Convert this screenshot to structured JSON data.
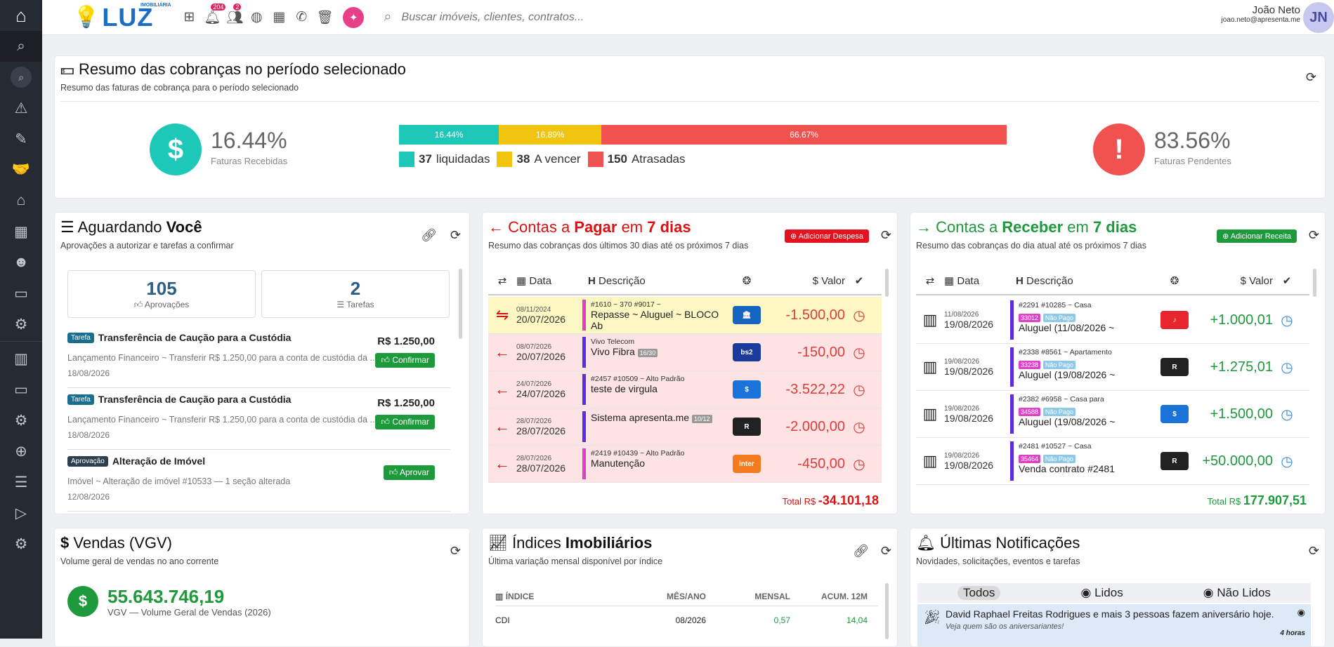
{
  "topbar": {
    "brand_small": "IMOBILIÁRIA",
    "brand": "LUZ",
    "notif_badge": "204",
    "users_badge": "2",
    "search_placeholder": "Buscar imóveis, clientes, contratos...",
    "user_name": "João Neto",
    "user_email": "joao.neto@apresenta.me",
    "avatar": "JN"
  },
  "resumo": {
    "title": "Resumo das cobranças no período selecionado",
    "subtitle": "Resumo das faturas de cobrança para o período selecionado",
    "recebidas_pct": "16.44%",
    "recebidas_label": "Faturas Recebidas",
    "pendentes_pct": "83.56%",
    "pendentes_label": "Faturas Pendentes",
    "bar": [
      {
        "label": "16.44%",
        "value": 16.44,
        "color": "#1ec8b8"
      },
      {
        "label": "16.89%",
        "value": 16.89,
        "color": "#f1c40f"
      },
      {
        "label": "66.67%",
        "value": 66.67,
        "color": "#f0524f"
      }
    ],
    "legend": [
      {
        "count": "37",
        "label": "liquidadas",
        "color": "#1ec8b8"
      },
      {
        "count": "38",
        "label": "A vencer",
        "color": "#f1c40f"
      },
      {
        "count": "150",
        "label": "Atrasadas",
        "color": "#f0524f"
      }
    ]
  },
  "aguardando": {
    "title_a": "Aguardando ",
    "title_b": "Você",
    "subtitle": "Aprovações a autorizar e tarefas a confirmar",
    "aprovacoes_count": "105",
    "aprovacoes_label": "Aprovações",
    "tarefas_count": "2",
    "tarefas_label": "Tarefas",
    "items": [
      {
        "badge": "Tarefa",
        "title": "Transferência de Caução para a Custódia",
        "sub": "Lançamento Financeiro ~ Transferir R$ 1.250,00 para a conta de custódia da ...",
        "date": "18/08/2026",
        "value": "R$ 1.250,00",
        "button": "Confirmar"
      },
      {
        "badge": "Tarefa",
        "title": "Transferência de Caução para a Custódia",
        "sub": "Lançamento Financeiro ~ Transferir R$ 1.250,00 para a conta de custódia da ...",
        "date": "18/08/2026",
        "value": "R$ 1.250,00",
        "button": "Confirmar"
      },
      {
        "badge": "Aprovação",
        "title": "Alteração de Imóvel",
        "sub": "Imóvel ~ Alteração de imóvel #10533 — 1 seção alterada",
        "date": "12/08/2026",
        "value": "",
        "button": "Aprovar"
      }
    ]
  },
  "pagar": {
    "title_a": "Contas a ",
    "title_b": "Pagar",
    "title_c": " em ",
    "title_d": "7 dias",
    "subtitle": "Resumo das cobranças dos últimos 30 dias até os próximos 7 dias",
    "add_button": "Adicionar Despesa",
    "col_data": "Data",
    "col_desc": "Descrição",
    "col_valor": "Valor",
    "rows": [
      {
        "d1": "08/11/2024",
        "d2": "20/07/2026",
        "meta": "#1610 ~ 370  #9017 ~",
        "desc": "Repasse ~ Aluguel ~ BLOCO",
        "desc2": "Ab",
        "logo": "🏛",
        "logo_color": "#1565c0",
        "value": "-1.500,00",
        "bg": "#fdf7c3",
        "mark": "#e040c8"
      },
      {
        "d1": "08/07/2026",
        "d2": "20/07/2026",
        "meta": "Vivo Telecom",
        "desc": "Vivo Fibra",
        "tag": "16/30",
        "logo": "bs2",
        "logo_color": "#1b3a9e",
        "value": "-150,00",
        "bg": "#fde3e3",
        "mark": "#5a2ee0"
      },
      {
        "d1": "24/07/2026",
        "d2": "24/07/2026",
        "meta": "#2457  #10509 ~ Alto Padrão",
        "desc": "teste de virgula",
        "logo": "$",
        "logo_color": "#1a73d9",
        "value": "-3.522,22",
        "bg": "#fde3e3",
        "mark": "#5a2ee0"
      },
      {
        "d1": "28/07/2026",
        "d2": "28/07/2026",
        "meta": "",
        "desc": "Sistema apresenta.me",
        "tag": "10/12",
        "logo": "R",
        "logo_color": "#222",
        "value": "-2.000,00",
        "bg": "#fde3e3",
        "mark": "#5a2ee0"
      },
      {
        "d1": "28/07/2026",
        "d2": "28/07/2026",
        "meta": "#2419  #10439 ~ Alto Padrão",
        "desc": "Manutenção",
        "logo": "inter",
        "logo_color": "#f47a20",
        "value": "-450,00",
        "bg": "#fde3e3",
        "mark": "#e040c8"
      }
    ],
    "total_label": "Total R$",
    "total": "-34.101,18"
  },
  "receber": {
    "title_a": "Contas a ",
    "title_b": "Receber",
    "title_c": " em ",
    "title_d": "7 dias",
    "subtitle": "Resumo das cobranças do dia atual até os próximos 7 dias",
    "add_button": "Adicionar Receita",
    "col_data": "Data",
    "col_desc": "Descrição",
    "col_valor": "Valor",
    "rows": [
      {
        "d1": "11/08/2026",
        "d2": "19/08/2026",
        "meta": "#2291  #10285 ~ Casa",
        "num": "33012",
        "status": "Não Pago",
        "desc": "Aluguel (11/08/2026 ~",
        "logo": "♪",
        "logo_color": "#e8242f",
        "value": "+1.000,01"
      },
      {
        "d1": "19/08/2026",
        "d2": "19/08/2026",
        "meta": "#2338  #8561 ~ Apartamento",
        "num": "33238",
        "status": "Não Pago",
        "desc": "Aluguel (19/08/2026 ~",
        "logo": "R",
        "logo_color": "#222",
        "value": "+1.275,01"
      },
      {
        "d1": "19/08/2026",
        "d2": "19/08/2026",
        "meta": "#2382  #6958 ~ Casa para",
        "num": "34588",
        "status": "Não Pago",
        "desc": "Aluguel (19/08/2026 ~",
        "logo": "$",
        "logo_color": "#1a73d9",
        "value": "+1.500,00"
      },
      {
        "d1": "19/08/2026",
        "d2": "19/08/2026",
        "meta": "#2481  #10527 ~ Casa",
        "num": "35464",
        "status": "Não Pago",
        "desc": "Venda contrato #2481",
        "logo": "R",
        "logo_color": "#222",
        "value": "+50.000,00"
      }
    ],
    "total_label": "Total R$",
    "total": "177.907,51"
  },
  "vendas": {
    "title": "Vendas (VGV)",
    "subtitle": "Volume geral de vendas no ano corrente",
    "value": "55.643.746,19",
    "label": "VGV — Volume Geral de Vendas (2026)"
  },
  "indices": {
    "title_a": "Índices ",
    "title_b": "Imobiliários",
    "subtitle": "Última variação mensal disponível por índice",
    "col_indice": "ÍNDICE",
    "col_mes": "MÊS/ANO",
    "col_mensal": "MENSAL",
    "col_acum": "ACUM. 12M",
    "rows": [
      {
        "indice": "CDI",
        "mes": "08/2026",
        "mensal": "0,57",
        "acum": "14,04"
      }
    ]
  },
  "notificacoes": {
    "title": "Últimas Notificações",
    "subtitle": "Novidades, solicitações, eventos e tarefas",
    "tab_todos": "Todos",
    "tab_lidos": "Lidos",
    "tab_nao_lidos": "Não Lidos",
    "item_text": "David Raphael Freitas Rodrigues e mais 3 pessoas fazem aniversário hoje.",
    "item_sub": "Veja quem são os aniversariantes!",
    "item_time": "4 horas"
  }
}
